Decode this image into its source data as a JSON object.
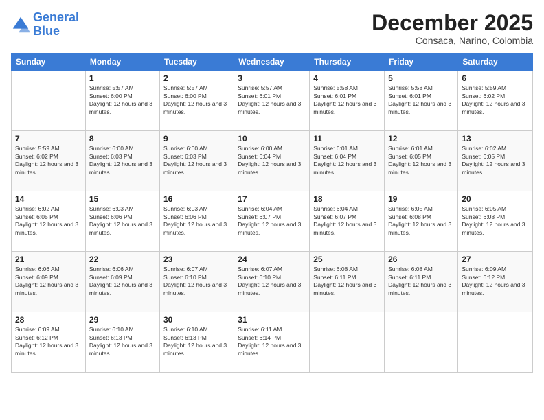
{
  "header": {
    "logo_line1": "General",
    "logo_line2": "Blue",
    "month": "December 2025",
    "location": "Consaca, Narino, Colombia"
  },
  "weekdays": [
    "Sunday",
    "Monday",
    "Tuesday",
    "Wednesday",
    "Thursday",
    "Friday",
    "Saturday"
  ],
  "weeks": [
    [
      {
        "day": "",
        "sunrise": "",
        "sunset": "",
        "daylight": ""
      },
      {
        "day": "1",
        "sunrise": "Sunrise: 5:57 AM",
        "sunset": "Sunset: 6:00 PM",
        "daylight": "Daylight: 12 hours and 3 minutes."
      },
      {
        "day": "2",
        "sunrise": "Sunrise: 5:57 AM",
        "sunset": "Sunset: 6:00 PM",
        "daylight": "Daylight: 12 hours and 3 minutes."
      },
      {
        "day": "3",
        "sunrise": "Sunrise: 5:57 AM",
        "sunset": "Sunset: 6:01 PM",
        "daylight": "Daylight: 12 hours and 3 minutes."
      },
      {
        "day": "4",
        "sunrise": "Sunrise: 5:58 AM",
        "sunset": "Sunset: 6:01 PM",
        "daylight": "Daylight: 12 hours and 3 minutes."
      },
      {
        "day": "5",
        "sunrise": "Sunrise: 5:58 AM",
        "sunset": "Sunset: 6:01 PM",
        "daylight": "Daylight: 12 hours and 3 minutes."
      },
      {
        "day": "6",
        "sunrise": "Sunrise: 5:59 AM",
        "sunset": "Sunset: 6:02 PM",
        "daylight": "Daylight: 12 hours and 3 minutes."
      }
    ],
    [
      {
        "day": "7",
        "sunrise": "Sunrise: 5:59 AM",
        "sunset": "Sunset: 6:02 PM",
        "daylight": "Daylight: 12 hours and 3 minutes."
      },
      {
        "day": "8",
        "sunrise": "Sunrise: 6:00 AM",
        "sunset": "Sunset: 6:03 PM",
        "daylight": "Daylight: 12 hours and 3 minutes."
      },
      {
        "day": "9",
        "sunrise": "Sunrise: 6:00 AM",
        "sunset": "Sunset: 6:03 PM",
        "daylight": "Daylight: 12 hours and 3 minutes."
      },
      {
        "day": "10",
        "sunrise": "Sunrise: 6:00 AM",
        "sunset": "Sunset: 6:04 PM",
        "daylight": "Daylight: 12 hours and 3 minutes."
      },
      {
        "day": "11",
        "sunrise": "Sunrise: 6:01 AM",
        "sunset": "Sunset: 6:04 PM",
        "daylight": "Daylight: 12 hours and 3 minutes."
      },
      {
        "day": "12",
        "sunrise": "Sunrise: 6:01 AM",
        "sunset": "Sunset: 6:05 PM",
        "daylight": "Daylight: 12 hours and 3 minutes."
      },
      {
        "day": "13",
        "sunrise": "Sunrise: 6:02 AM",
        "sunset": "Sunset: 6:05 PM",
        "daylight": "Daylight: 12 hours and 3 minutes."
      }
    ],
    [
      {
        "day": "14",
        "sunrise": "Sunrise: 6:02 AM",
        "sunset": "Sunset: 6:05 PM",
        "daylight": "Daylight: 12 hours and 3 minutes."
      },
      {
        "day": "15",
        "sunrise": "Sunrise: 6:03 AM",
        "sunset": "Sunset: 6:06 PM",
        "daylight": "Daylight: 12 hours and 3 minutes."
      },
      {
        "day": "16",
        "sunrise": "Sunrise: 6:03 AM",
        "sunset": "Sunset: 6:06 PM",
        "daylight": "Daylight: 12 hours and 3 minutes."
      },
      {
        "day": "17",
        "sunrise": "Sunrise: 6:04 AM",
        "sunset": "Sunset: 6:07 PM",
        "daylight": "Daylight: 12 hours and 3 minutes."
      },
      {
        "day": "18",
        "sunrise": "Sunrise: 6:04 AM",
        "sunset": "Sunset: 6:07 PM",
        "daylight": "Daylight: 12 hours and 3 minutes."
      },
      {
        "day": "19",
        "sunrise": "Sunrise: 6:05 AM",
        "sunset": "Sunset: 6:08 PM",
        "daylight": "Daylight: 12 hours and 3 minutes."
      },
      {
        "day": "20",
        "sunrise": "Sunrise: 6:05 AM",
        "sunset": "Sunset: 6:08 PM",
        "daylight": "Daylight: 12 hours and 3 minutes."
      }
    ],
    [
      {
        "day": "21",
        "sunrise": "Sunrise: 6:06 AM",
        "sunset": "Sunset: 6:09 PM",
        "daylight": "Daylight: 12 hours and 3 minutes."
      },
      {
        "day": "22",
        "sunrise": "Sunrise: 6:06 AM",
        "sunset": "Sunset: 6:09 PM",
        "daylight": "Daylight: 12 hours and 3 minutes."
      },
      {
        "day": "23",
        "sunrise": "Sunrise: 6:07 AM",
        "sunset": "Sunset: 6:10 PM",
        "daylight": "Daylight: 12 hours and 3 minutes."
      },
      {
        "day": "24",
        "sunrise": "Sunrise: 6:07 AM",
        "sunset": "Sunset: 6:10 PM",
        "daylight": "Daylight: 12 hours and 3 minutes."
      },
      {
        "day": "25",
        "sunrise": "Sunrise: 6:08 AM",
        "sunset": "Sunset: 6:11 PM",
        "daylight": "Daylight: 12 hours and 3 minutes."
      },
      {
        "day": "26",
        "sunrise": "Sunrise: 6:08 AM",
        "sunset": "Sunset: 6:11 PM",
        "daylight": "Daylight: 12 hours and 3 minutes."
      },
      {
        "day": "27",
        "sunrise": "Sunrise: 6:09 AM",
        "sunset": "Sunset: 6:12 PM",
        "daylight": "Daylight: 12 hours and 3 minutes."
      }
    ],
    [
      {
        "day": "28",
        "sunrise": "Sunrise: 6:09 AM",
        "sunset": "Sunset: 6:12 PM",
        "daylight": "Daylight: 12 hours and 3 minutes."
      },
      {
        "day": "29",
        "sunrise": "Sunrise: 6:10 AM",
        "sunset": "Sunset: 6:13 PM",
        "daylight": "Daylight: 12 hours and 3 minutes."
      },
      {
        "day": "30",
        "sunrise": "Sunrise: 6:10 AM",
        "sunset": "Sunset: 6:13 PM",
        "daylight": "Daylight: 12 hours and 3 minutes."
      },
      {
        "day": "31",
        "sunrise": "Sunrise: 6:11 AM",
        "sunset": "Sunset: 6:14 PM",
        "daylight": "Daylight: 12 hours and 3 minutes."
      },
      {
        "day": "",
        "sunrise": "",
        "sunset": "",
        "daylight": ""
      },
      {
        "day": "",
        "sunrise": "",
        "sunset": "",
        "daylight": ""
      },
      {
        "day": "",
        "sunrise": "",
        "sunset": "",
        "daylight": ""
      }
    ]
  ]
}
